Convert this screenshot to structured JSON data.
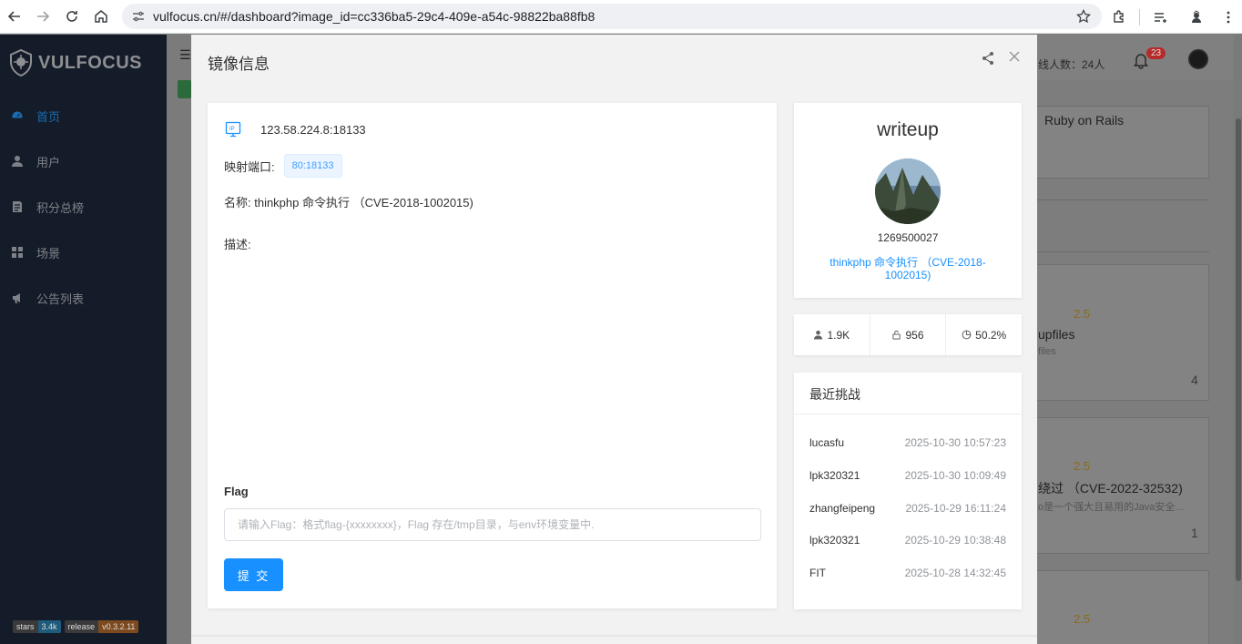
{
  "browser": {
    "url": "vulfocus.cn/#/dashboard?image_id=cc336ba5-29c4-409e-a54c-98822ba88fb8"
  },
  "sidebar": {
    "logo_text": "VULFOCUS",
    "items": [
      {
        "label": "首页",
        "icon": "dashboard-icon",
        "active": true
      },
      {
        "label": "用户",
        "icon": "user-icon",
        "active": false
      },
      {
        "label": "积分总榜",
        "icon": "document-icon",
        "active": false
      },
      {
        "label": "场景",
        "icon": "grid-icon",
        "active": false
      },
      {
        "label": "公告列表",
        "icon": "megaphone-icon",
        "active": false
      }
    ],
    "badges": {
      "stars_key": "stars",
      "stars_val": "3.4k",
      "release_key": "release",
      "release_val": "v0.3.2.11"
    }
  },
  "header": {
    "online_text": "线人数：24人",
    "notification_count": "23"
  },
  "background_cards": {
    "card1_text": "Ruby on Rails",
    "card2_score": "2.5",
    "card2_title": "upfiles",
    "card2_sub": "files",
    "card2_count": "4",
    "card3_score": "2.5",
    "card3_title": "绕过 （CVE-2022-32532)",
    "card3_sub": "o是一个强大且易用的Java安全...",
    "card3_count": "1",
    "card4_score": "2.5"
  },
  "modal": {
    "title": "镜像信息",
    "ip": "123.58.224.8:18133",
    "port_label": "映射端口:",
    "port_value": "80:18133",
    "name_line": "名称: thinkphp 命令执行 （CVE-2018-1002015)",
    "desc_label": "描述:",
    "flag_label": "Flag",
    "flag_placeholder": "请输入Flag：格式flag-{xxxxxxxx}，Flag 存在/tmp目录，与env环境变量中.",
    "submit_label": "提 交",
    "writeup": {
      "title": "writeup",
      "user_id": "1269500027",
      "link_text": "thinkphp 命令执行 （CVE-2018-1002015)"
    },
    "stats": {
      "users": "1.9K",
      "solved": "956",
      "rate": "50.2%"
    },
    "recent": {
      "title": "最近挑战",
      "rows": [
        {
          "user": "lucasfu",
          "time": "2025-10-30 10:57:23"
        },
        {
          "user": "lpk320321",
          "time": "2025-10-30 10:09:49"
        },
        {
          "user": "zhangfeipeng",
          "time": "2025-10-29 16:11:24"
        },
        {
          "user": "lpk320321",
          "time": "2025-10-29 10:38:48"
        },
        {
          "user": "FIT",
          "time": "2025-10-28 14:32:45"
        }
      ]
    }
  }
}
